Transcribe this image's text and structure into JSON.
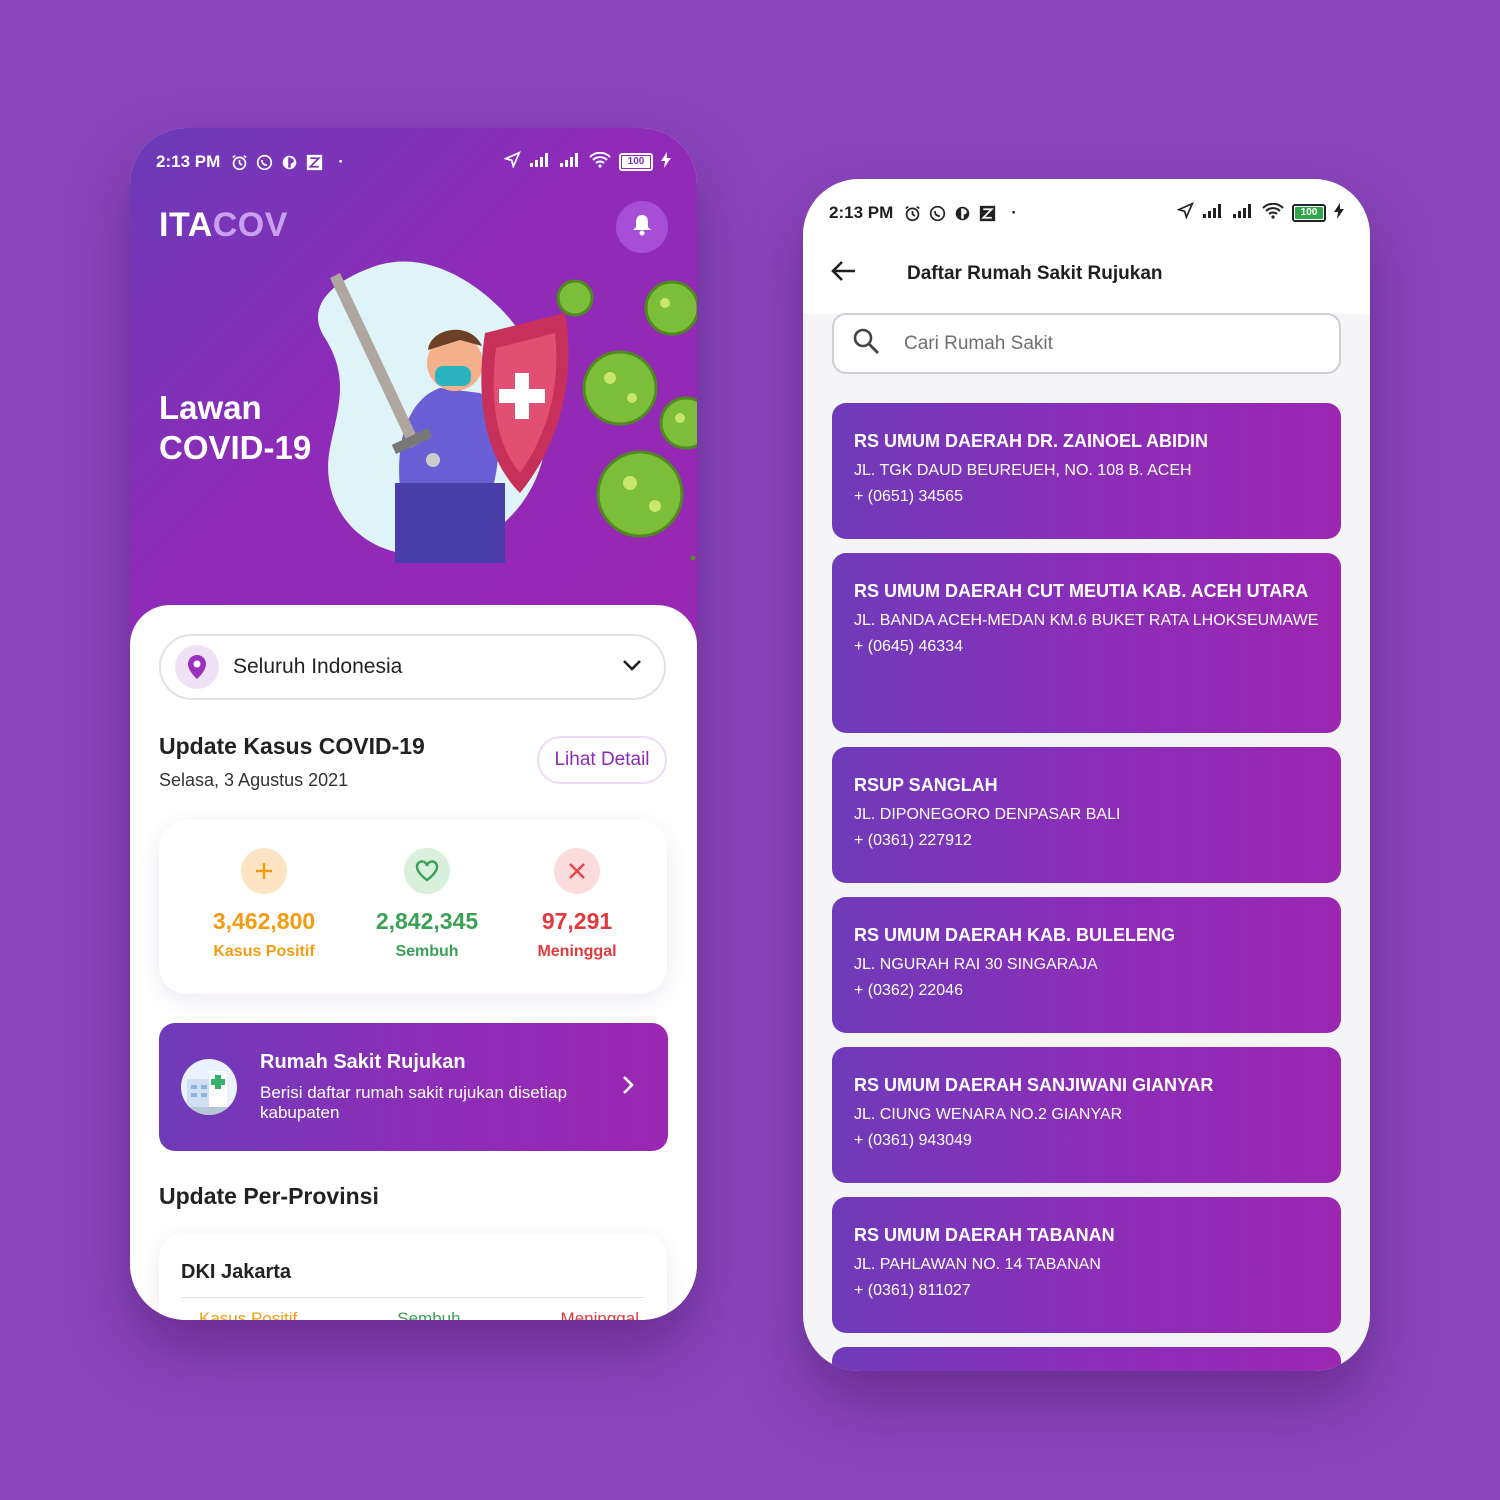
{
  "status": {
    "time": "2:13 PM",
    "battery": "100"
  },
  "left": {
    "logo_a": "ITA",
    "logo_b": "COV",
    "hero_title_1": "Lawan",
    "hero_title_2": "COVID-19",
    "region": "Seluruh Indonesia",
    "update_title": "Update Kasus COVID-19",
    "update_date": "Selasa, 3 Agustus 2021",
    "detail_label": "Lihat Detail",
    "stats": {
      "positive": {
        "value": "3,462,800",
        "label": "Kasus Positif"
      },
      "recovered": {
        "value": "2,842,345",
        "label": "Sembuh"
      },
      "deaths": {
        "value": "97,291",
        "label": "Meninggal"
      }
    },
    "banner": {
      "title": "Rumah Sakit Rujukan",
      "desc": "Berisi daftar rumah sakit rujukan disetiap kabupaten"
    },
    "province_title": "Update Per-Provinsi",
    "province": {
      "name": "DKI Jakarta",
      "col1": "Kasus Positif",
      "col2": "Sembuh",
      "col3": "Meninggal"
    }
  },
  "right": {
    "title": "Daftar Rumah Sakit Rujukan",
    "search_placeholder": "Cari Rumah Sakit",
    "hospitals": [
      {
        "name": "RS UMUM DAERAH  DR. ZAINOEL ABIDIN",
        "address": "JL. TGK DAUD BEUREUEH, NO. 108 B. ACEH",
        "phone": "+ (0651) 34565"
      },
      {
        "name": "RS UMUM DAERAH CUT MEUTIA KAB. ACEH UTARA",
        "address": "JL. BANDA ACEH-MEDAN KM.6 BUKET RATA LHOKSEUMAWE",
        "phone": "+ (0645) 46334"
      },
      {
        "name": "RSUP SANGLAH",
        "address": "JL. DIPONEGORO DENPASAR BALI",
        "phone": "+ (0361) 227912"
      },
      {
        "name": "RS UMUM DAERAH KAB. BULELENG",
        "address": "JL. NGURAH RAI 30 SINGARAJA",
        "phone": "+ (0362) 22046"
      },
      {
        "name": "RS UMUM DAERAH SANJIWANI GIANYAR",
        "address": "JL. CIUNG WENARA NO.2 GIANYAR",
        "phone": "+ (0361) 943049"
      },
      {
        "name": "RS UMUM DAERAH TABANAN",
        "address": "JL. PAHLAWAN NO. 14 TABANAN",
        "phone": "+ (0361) 811027"
      }
    ]
  },
  "colors": {
    "primary": "#8e2bb8",
    "positive": "#f39c12",
    "recovered": "#3ba156",
    "deaths": "#e03a3e"
  },
  "icons": [
    "alarm-icon",
    "whatsapp-icon",
    "app-icon",
    "z-icon",
    "location-arrow-icon",
    "signal-icon",
    "wifi-icon",
    "battery-icon",
    "charging-icon",
    "bell-icon",
    "pin-icon",
    "chevron-down-icon",
    "plus-icon",
    "heart-icon",
    "close-icon",
    "hospital-icon",
    "chevron-right-icon",
    "back-arrow-icon",
    "search-icon"
  ]
}
